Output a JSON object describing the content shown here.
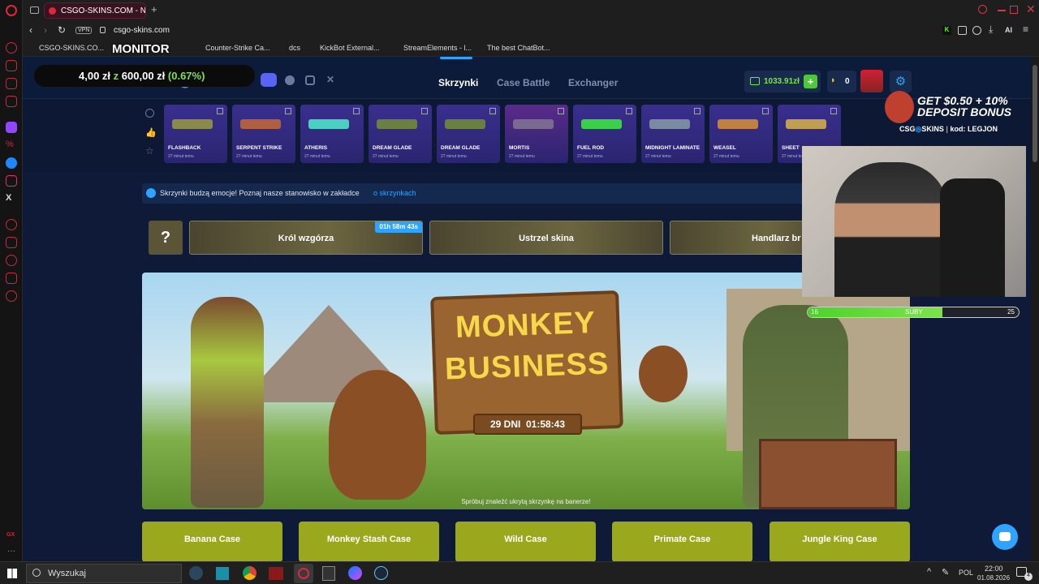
{
  "browser": {
    "tab_title": "CSGO-SKINS.COM - Najlep",
    "url": "csgo-skins.com",
    "vpn_label": "VPN",
    "ai_label": "AI",
    "bookmarks": [
      "CSGO-SKINS.CO...",
      "Counter-Strike Ca...",
      "dcs",
      "KickBot External...",
      "StreamElements - l...",
      "The best ChatBot..."
    ]
  },
  "overlay": {
    "monitor_label": "MONITOR",
    "ticker_prefix": "4,00 zł",
    "ticker_mid": "z",
    "ticker_total": "600,00 zł",
    "ticker_pct": "(0.67%)",
    "bonus_line1": "GET $0.50 + 10%",
    "bonus_line2": "DEPOSIT BONUS",
    "bonus_brand": "CSG",
    "bonus_brand2": "SKINS",
    "bonus_code": "kod: LEGJON",
    "sub_goal": {
      "current": "16",
      "label": "SUBY",
      "target": "25",
      "progress": 0.64
    }
  },
  "site": {
    "logo": "CSG",
    "logo2": "SKINS",
    "nav": [
      "Skrzynki",
      "Case Battle",
      "Exchanger"
    ],
    "balance": "1033.91zł",
    "bananas": "0",
    "notice": "Skrzynki budzą emocje! Poznaj nasze stanowisko w zakładce",
    "notice_link": "o skrzynkach",
    "question": "?",
    "banners": [
      {
        "label": "Król wzgórza",
        "timer": "01h 58m 43s"
      },
      {
        "label": "Ustrzel skina"
      },
      {
        "label": "Handlarz br"
      }
    ],
    "hero_title1": "MONKEY",
    "hero_title2": "BUSINESS",
    "hero_countdown": "29 DNI  01:58:43",
    "hero_hint": "Spróbuj znaleźć ukrytą skrzynkę na banerze!",
    "cases": [
      "Banana Case",
      "Monkey Stash Case",
      "Wild Case",
      "Primate Case",
      "Jungle King Case"
    ]
  },
  "recent_drops": [
    {
      "name": "FLASHBACK",
      "time": "27 minut temu"
    },
    {
      "name": "SERPENT STRIKE",
      "time": "27 minut temu"
    },
    {
      "name": "ATHERIS",
      "time": "27 minut temu"
    },
    {
      "name": "DREAM GLADE",
      "time": "27 minut temu"
    },
    {
      "name": "DREAM GLADE",
      "time": "27 minut temu"
    },
    {
      "name": "MORTIS",
      "time": "27 minut temu"
    },
    {
      "name": "FUEL ROD",
      "time": "27 minut temu"
    },
    {
      "name": "MIDNIGHT LAMINATE",
      "time": "27 minut temu"
    },
    {
      "name": "WEASEL",
      "time": "27 minut temu"
    },
    {
      "name": "SHEET",
      "time": "27 minut temu"
    }
  ],
  "taskbar": {
    "search_placeholder": "Wyszukaj",
    "lang": "POL",
    "time": "22:00",
    "date": "01.08.2026",
    "notif_count": "4"
  }
}
